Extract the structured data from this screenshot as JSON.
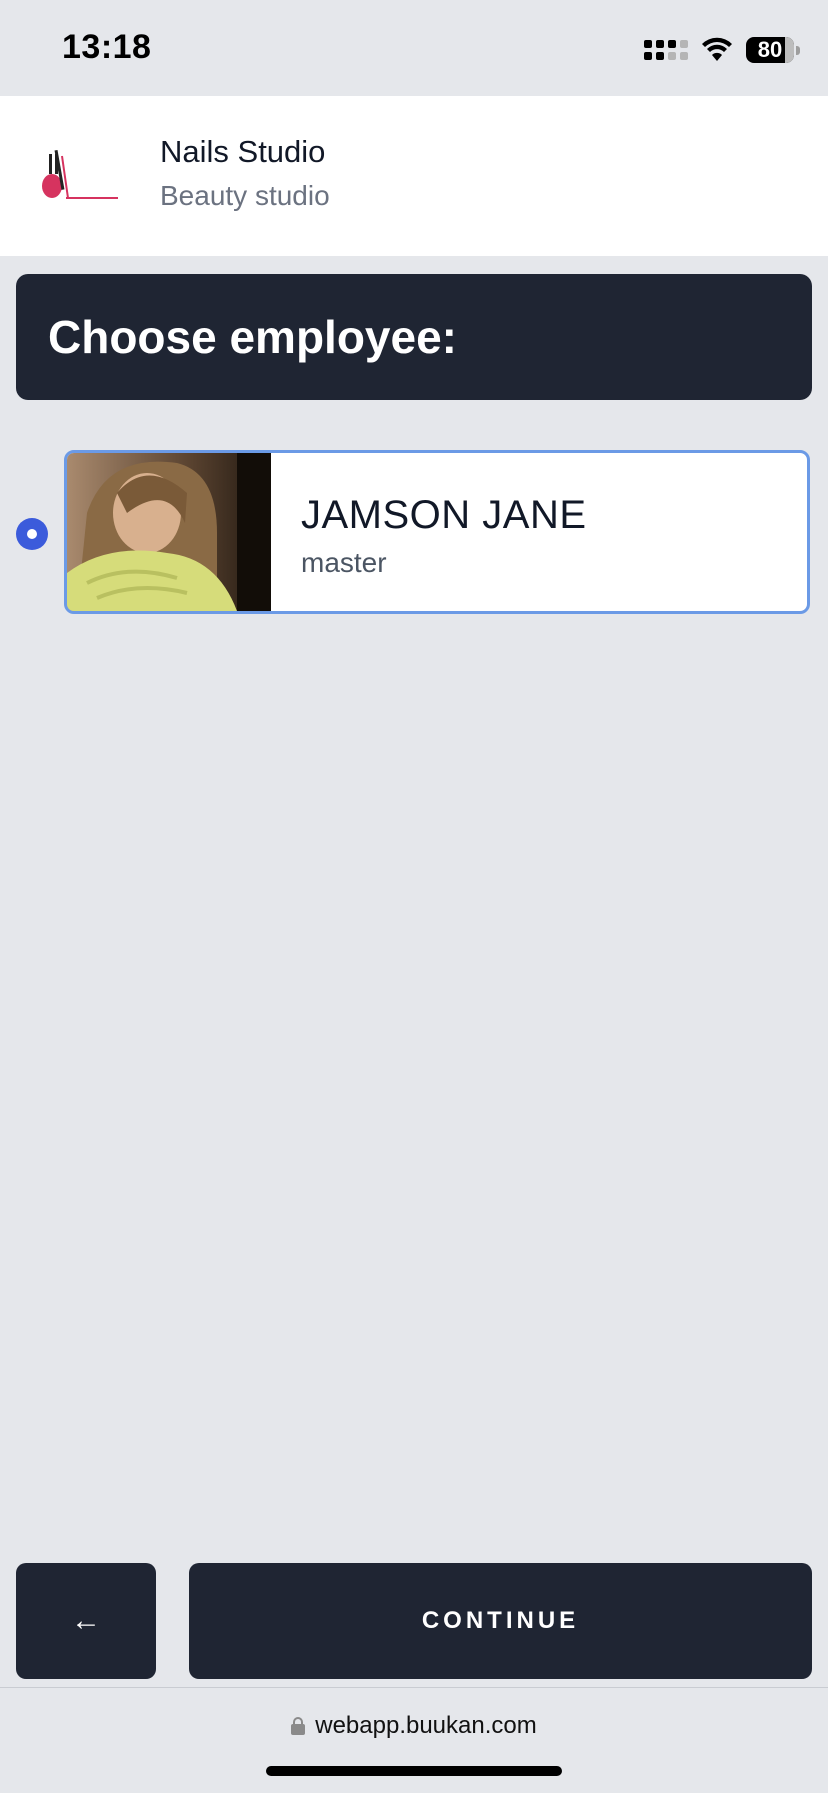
{
  "status_bar": {
    "time": "13:18",
    "battery": "80",
    "icons": [
      "signal-icon",
      "wifi-icon",
      "battery-icon"
    ]
  },
  "header": {
    "logo_text": "NAILS STUDIO",
    "studio_name": "Nails Studio",
    "studio_type": "Beauty studio"
  },
  "title": "Choose employee:",
  "employees": [
    {
      "name": "JAMSON JANE",
      "role": "master",
      "selected": true
    }
  ],
  "buttons": {
    "back_icon": "←",
    "continue_label": "CONTINUE"
  },
  "browser": {
    "url": "webapp.buukan.com"
  },
  "colors": {
    "dark": "#1f2533",
    "background": "#e5e7eb",
    "selected_border": "#6b9ae6",
    "radio": "#3b5bdb"
  }
}
